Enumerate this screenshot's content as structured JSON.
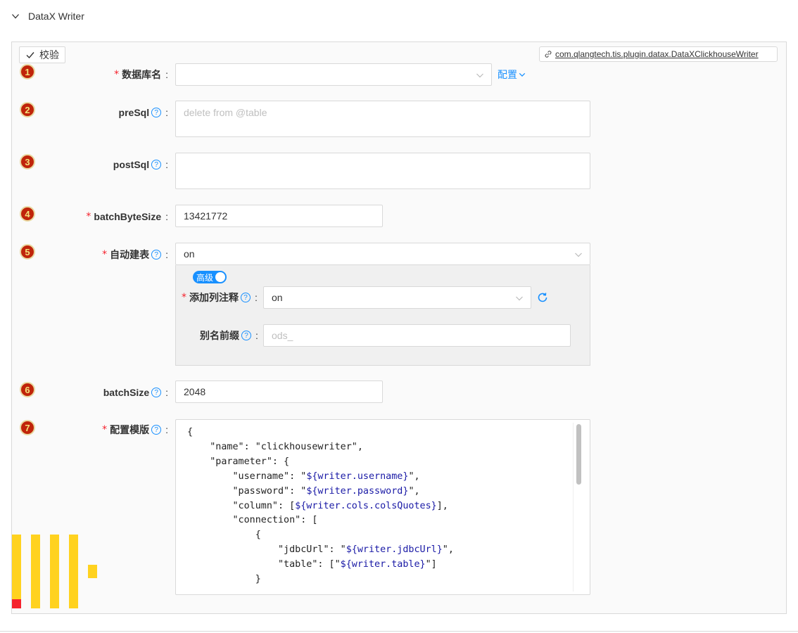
{
  "panel": {
    "title": "DataX Writer"
  },
  "toolbar": {
    "verify_label": "校验",
    "plugin_link": "com.qlangtech.tis.plugin.datax.DataXClickhouseWriter"
  },
  "fields": {
    "dbName": {
      "num": "1",
      "label": "数据库名",
      "value": "",
      "config_label": "配置"
    },
    "preSql": {
      "num": "2",
      "label": "preSql",
      "placeholder": "delete from @table"
    },
    "postSql": {
      "num": "3",
      "label": "postSql",
      "value": ""
    },
    "batchByteSize": {
      "num": "4",
      "label": "batchByteSize",
      "value": "13421772"
    },
    "autoCreateTable": {
      "num": "5",
      "label": "自动建表",
      "value": "on"
    },
    "batchSize": {
      "num": "6",
      "label": "batchSize",
      "value": "2048"
    },
    "template": {
      "num": "7",
      "label": "配置模版"
    }
  },
  "advanced": {
    "toggle_label": "高级",
    "addComment": {
      "label": "添加列注释",
      "value": "on"
    },
    "aliasPrefix": {
      "label": "别名前缀",
      "placeholder": "ods_"
    }
  },
  "code_lines": [
    {
      "t": "{",
      "v": ""
    },
    {
      "t": "    \"name\": \"clickhousewriter\",",
      "v": ""
    },
    {
      "t": "    \"parameter\": {",
      "v": ""
    },
    {
      "t": "        \"username\": \"",
      "v": "${writer.username}",
      "e": "\","
    },
    {
      "t": "        \"password\": \"",
      "v": "${writer.password}",
      "e": "\","
    },
    {
      "t": "        \"column\": [",
      "v": "${writer.cols.colsQuotes}",
      "e": "],"
    },
    {
      "t": "        \"connection\": [",
      "v": ""
    },
    {
      "t": "            {",
      "v": ""
    },
    {
      "t": "                \"jdbcUrl\": \"",
      "v": "${writer.jdbcUrl}",
      "e": "\","
    },
    {
      "t": "                \"table\": [\"",
      "v": "${writer.table}",
      "e": "\"]"
    },
    {
      "t": "            }",
      "v": ""
    }
  ],
  "colors": {
    "accent": "#1890ff",
    "required": "#f5222d",
    "badge": "#c0240a"
  }
}
